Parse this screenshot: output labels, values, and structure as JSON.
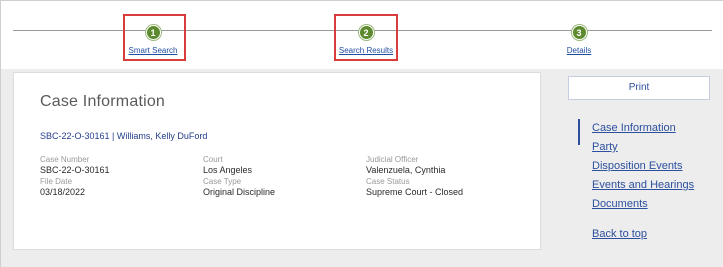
{
  "stepper": {
    "steps": [
      {
        "number": "1",
        "label": "Smart Search"
      },
      {
        "number": "2",
        "label": "Search Results"
      },
      {
        "number": "3",
        "label": "Details"
      }
    ]
  },
  "case": {
    "title": "Case Information",
    "subtitle": "SBC-22-O-30161 | Williams, Kelly DuFord",
    "fields": {
      "case_number_label": "Case Number",
      "case_number": "SBC-22-O-30161",
      "file_date_label": "File Date",
      "file_date": "03/18/2022",
      "court_label": "Court",
      "court": "Los Angeles",
      "case_type_label": "Case Type",
      "case_type": "Original Discipline",
      "judicial_officer_label": "Judicial Officer",
      "judicial_officer": "Valenzuela, Cynthia",
      "case_status_label": "Case Status",
      "case_status": "Supreme Court - Closed"
    }
  },
  "sidebar": {
    "print_label": "Print",
    "nav": [
      {
        "label": "Case Information"
      },
      {
        "label": "Party"
      },
      {
        "label": "Disposition Events"
      },
      {
        "label": "Events and Hearings"
      },
      {
        "label": "Documents"
      }
    ],
    "back_to_top": "Back to top"
  },
  "colors": {
    "step_dot": "#5e8a2f",
    "link": "#2c4f9e",
    "highlight": "#d93c3c"
  }
}
